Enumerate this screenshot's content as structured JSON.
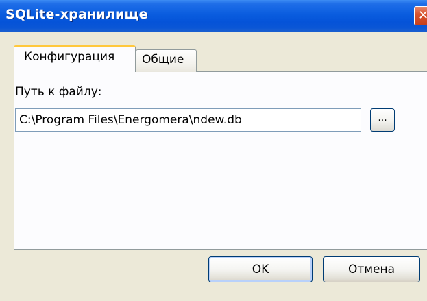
{
  "window": {
    "title": "SQLite-хранилище",
    "close_glyph": "✕"
  },
  "tabs": [
    {
      "label": "Конфигурация",
      "active": true
    },
    {
      "label": "Общие",
      "active": false
    }
  ],
  "config": {
    "path_label": "Путь к файлу:",
    "path_value": "C:\\Program Files\\Energomera\\ndew.db",
    "browse_label": "..."
  },
  "footer": {
    "ok_label": "OK",
    "cancel_label": "Отмена"
  },
  "colors": {
    "titlebar": "#0a5ddf",
    "dialog_bg": "#ece9d8",
    "active_tab_accent": "#ffc83c",
    "close_button": "#d9542f"
  }
}
